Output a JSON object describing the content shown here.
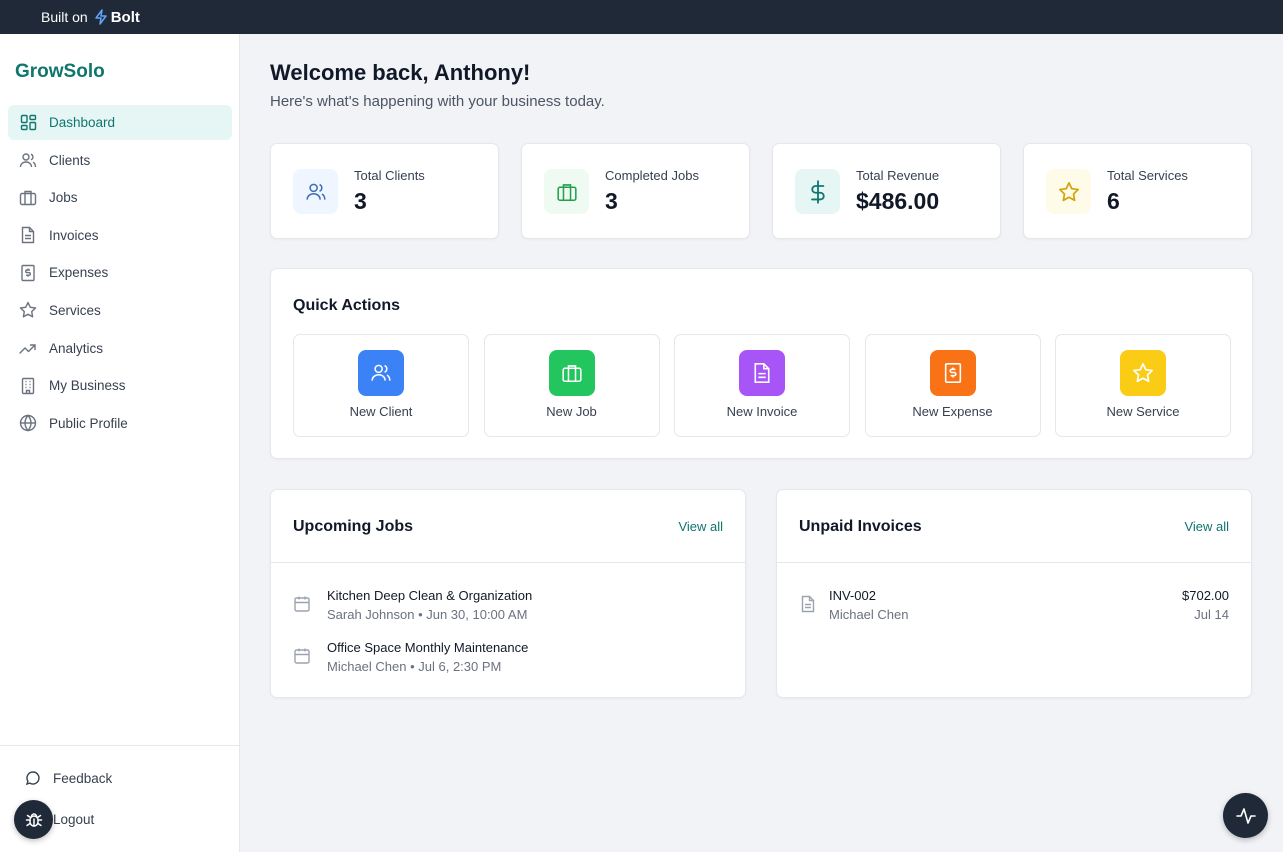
{
  "topbar": {
    "built_on": "Built on",
    "bolt": "Bolt"
  },
  "brand": "GrowSolo",
  "nav": [
    {
      "label": "Dashboard",
      "icon": "dashboard-icon",
      "active": true
    },
    {
      "label": "Clients",
      "icon": "users-icon"
    },
    {
      "label": "Jobs",
      "icon": "briefcase-icon"
    },
    {
      "label": "Invoices",
      "icon": "file-icon"
    },
    {
      "label": "Expenses",
      "icon": "receipt-icon"
    },
    {
      "label": "Services",
      "icon": "star-icon"
    },
    {
      "label": "Analytics",
      "icon": "trending-up-icon"
    },
    {
      "label": "My Business",
      "icon": "building-icon"
    },
    {
      "label": "Public Profile",
      "icon": "globe-icon"
    }
  ],
  "bottom": {
    "feedback": "Feedback",
    "logout": "Logout"
  },
  "welcome": "Welcome back, Anthony!",
  "subtitle": "Here's what's happening with your business today.",
  "stats": [
    {
      "label": "Total Clients",
      "value": "3",
      "icon": "users-icon"
    },
    {
      "label": "Completed Jobs",
      "value": "3",
      "icon": "briefcase-icon"
    },
    {
      "label": "Total Revenue",
      "value": "$486.00",
      "icon": "dollar-icon"
    },
    {
      "label": "Total Services",
      "value": "6",
      "icon": "star-icon"
    }
  ],
  "quick_actions": {
    "title": "Quick Actions",
    "items": [
      {
        "label": "New Client",
        "icon": "users-icon",
        "color": "#3b82f6"
      },
      {
        "label": "New Job",
        "icon": "briefcase-icon",
        "color": "#22c55e"
      },
      {
        "label": "New Invoice",
        "icon": "file-icon",
        "color": "#a855f7"
      },
      {
        "label": "New Expense",
        "icon": "receipt-icon",
        "color": "#f97316"
      },
      {
        "label": "New Service",
        "icon": "star-icon",
        "color": "#facc15"
      }
    ]
  },
  "upcoming_jobs": {
    "title": "Upcoming Jobs",
    "view_all": "View all",
    "items": [
      {
        "title": "Kitchen Deep Clean & Organization",
        "meta": "Sarah Johnson • Jun 30, 10:00 AM"
      },
      {
        "title": "Office Space Monthly Maintenance",
        "meta": "Michael Chen • Jul 6, 2:30 PM"
      }
    ]
  },
  "unpaid_invoices": {
    "title": "Unpaid Invoices",
    "view_all": "View all",
    "items": [
      {
        "number": "INV-002",
        "client": "Michael Chen",
        "amount": "$702.00",
        "date": "Jul 14"
      }
    ]
  },
  "colors": {
    "accent": "#0f766e",
    "topbar": "#1f2937"
  }
}
